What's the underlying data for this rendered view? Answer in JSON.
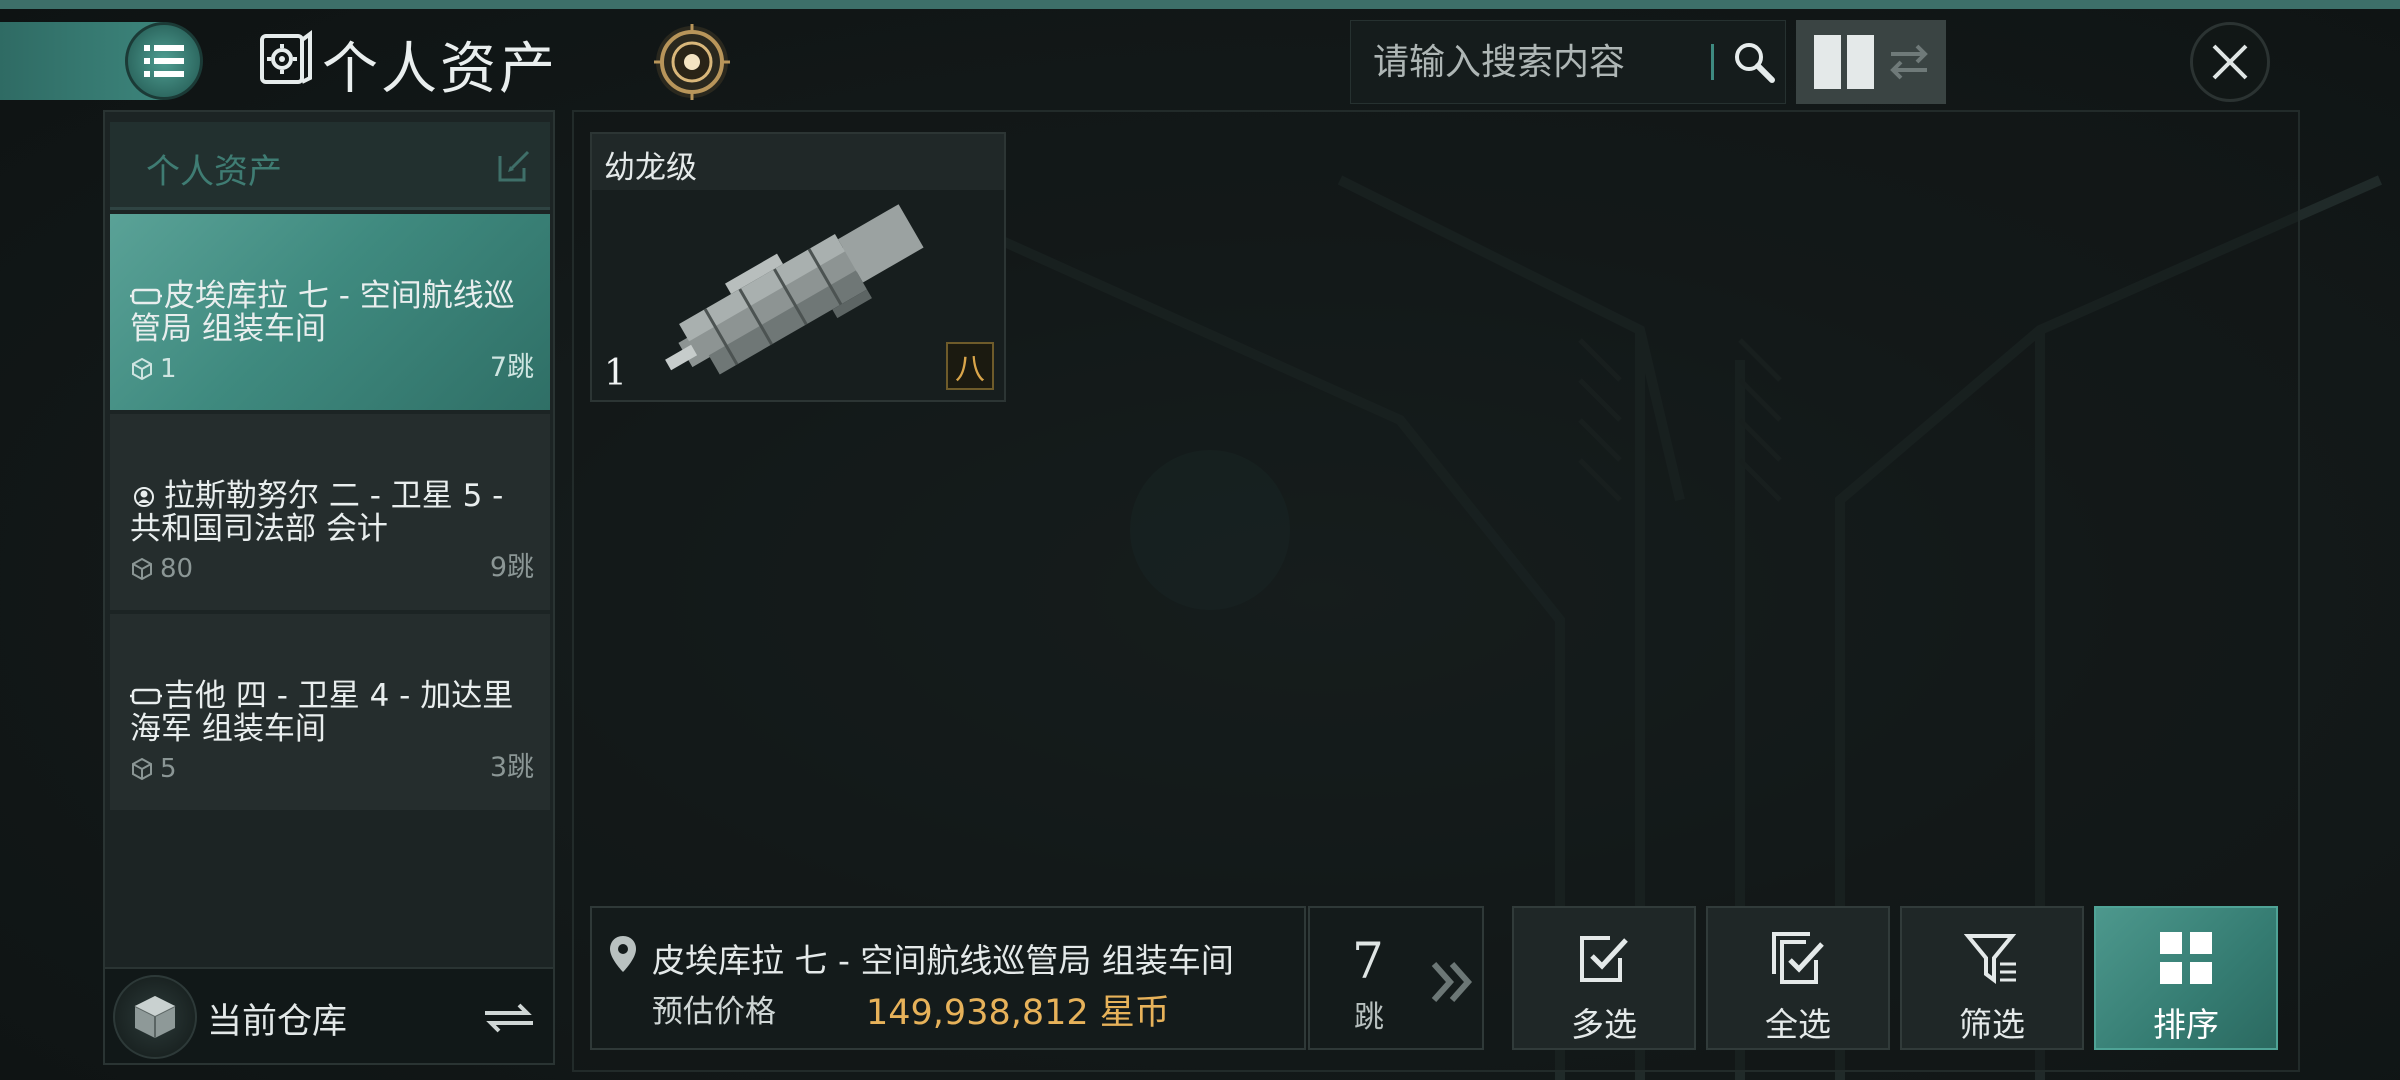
{
  "header": {
    "title": "个人资产",
    "search_placeholder": "请输入搜索内容"
  },
  "sidebar": {
    "header_label": "个人资产",
    "locations": [
      {
        "name": "皮埃库拉 七 - 空间航线巡管局 组装车间",
        "count": "1",
        "jumps": "7跳",
        "active": true,
        "icon": "structure-icon"
      },
      {
        "name": "拉斯勒努尔 二 - 卫星 5 - 共和国司法部 会计",
        "count": "80",
        "jumps": "9跳",
        "active": false,
        "icon": "agent-icon"
      },
      {
        "name": "吉他 四 - 卫星 4 - 加达里海军 组装车间",
        "count": "5",
        "jumps": "3跳",
        "active": false,
        "icon": "structure-icon"
      }
    ],
    "warehouse_label": "当前仓库"
  },
  "main": {
    "ship": {
      "name": "幼龙级",
      "quantity": "1",
      "tier": "八"
    }
  },
  "footer": {
    "location": "皮埃库拉 七 - 空间航线巡管局 组装车间",
    "price_label": "预估价格",
    "price_value": "149,938,812 星币",
    "jumps_number": "7",
    "jumps_label": "跳",
    "actions": {
      "multi_select": "多选",
      "select_all": "全选",
      "filter": "筛选",
      "sort": "排序"
    }
  },
  "colors": {
    "accent": "#3f8a80",
    "price": "#e7b25a",
    "tier_border": "#6e5b2a"
  }
}
